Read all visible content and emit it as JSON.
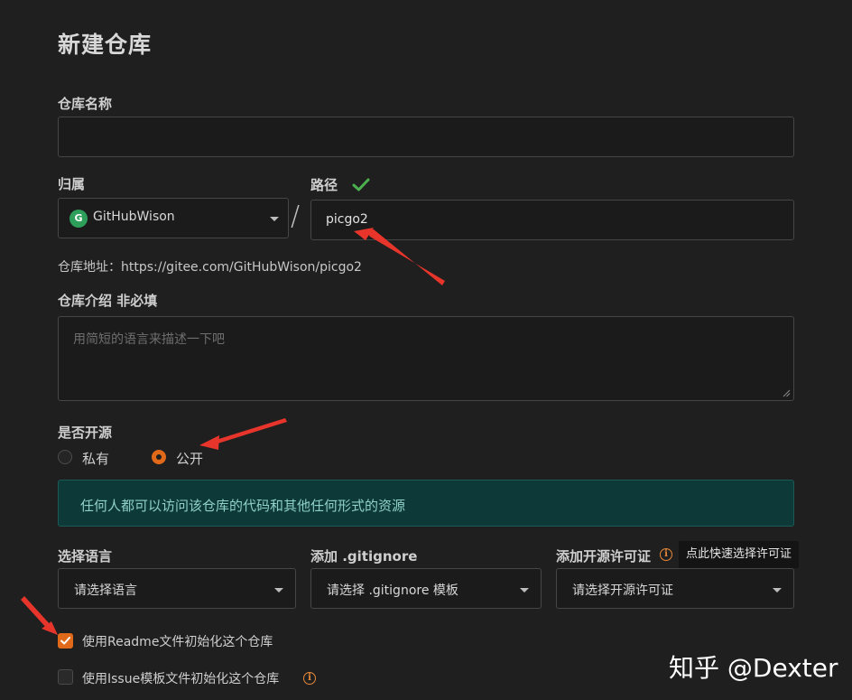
{
  "page": {
    "title": "新建仓库"
  },
  "repo_name": {
    "label": "仓库名称",
    "value": ""
  },
  "owner": {
    "label": "归属",
    "avatar_letter": "G",
    "value": "GitHubWison"
  },
  "separator": "/",
  "path": {
    "label": "路径",
    "value": "picgo2"
  },
  "repo_url": {
    "text": "仓库地址：https://gitee.com/GitHubWison/picgo2"
  },
  "description": {
    "label": "仓库介绍 非必填",
    "placeholder": "用简短的语言来描述一下吧"
  },
  "visibility": {
    "label": "是否开源",
    "options": [
      {
        "label": "私有",
        "selected": false
      },
      {
        "label": "公开",
        "selected": true
      }
    ],
    "notice": "任何人都可以访问该仓库的代码和其他任何形式的资源"
  },
  "language": {
    "label": "选择语言",
    "value": "请选择语言"
  },
  "gitignore": {
    "label": "添加 .gitignore",
    "value": "请选择 .gitignore 模板"
  },
  "license": {
    "label": "添加开源许可证",
    "value": "请选择开源许可证",
    "tooltip": "点此快速选择许可证"
  },
  "init_readme": {
    "label": "使用Readme文件初始化这个仓库",
    "checked": true
  },
  "init_issue": {
    "label": "使用Issue模板文件初始化这个仓库",
    "checked": false
  },
  "watermark": {
    "text": "知乎 @Dexter"
  },
  "colors": {
    "accent": "#e06a1a",
    "success": "#4caf50",
    "notice_bg": "#0d3a38",
    "notice_text": "#8fd0c8",
    "arrow": "#e8352c"
  }
}
